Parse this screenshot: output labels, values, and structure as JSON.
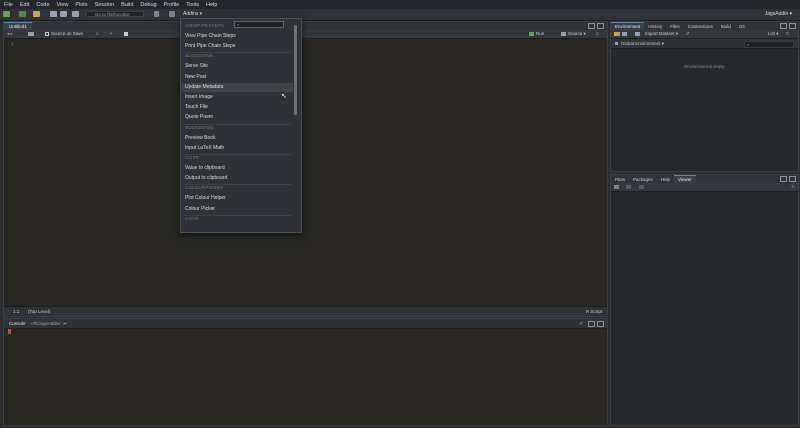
{
  "menu": [
    "File",
    "Edit",
    "Code",
    "View",
    "Plots",
    "Session",
    "Build",
    "Debug",
    "Profile",
    "Tools",
    "Help"
  ],
  "toolbar": {
    "goto_placeholder": "Go to file/function",
    "addins_label": "Addins ▾",
    "project_label": "JagsAddin ▾"
  },
  "editor": {
    "tab_label": "Untitled1",
    "source_on_save": "Source on Save",
    "run_label": "Run",
    "source_label": "Source ▾",
    "line_number": "1"
  },
  "statusbar": {
    "position": "1:1",
    "scope": "(Top Level)",
    "file_type": "R Script"
  },
  "console": {
    "tab_label": "Console",
    "path": "~/R/JagsAddin/"
  },
  "addins_menu": {
    "items": [
      {
        "kind": "head",
        "label": "VIEWPIPESTEPS"
      },
      {
        "kind": "item",
        "label": "View Pipe Chain Steps"
      },
      {
        "kind": "item",
        "label": "Print Pipe Chain Steps"
      },
      {
        "kind": "head",
        "label": "BLOGDOWN"
      },
      {
        "kind": "item",
        "label": "Serve Site"
      },
      {
        "kind": "item",
        "label": "New Post"
      },
      {
        "kind": "item",
        "label": "Update Metadata",
        "highlighted": true
      },
      {
        "kind": "item",
        "label": "Insert Image"
      },
      {
        "kind": "item",
        "label": "Touch File"
      },
      {
        "kind": "item",
        "label": "Quote Poem"
      },
      {
        "kind": "head",
        "label": "BOOKDOWN"
      },
      {
        "kind": "item",
        "label": "Preview Book"
      },
      {
        "kind": "item",
        "label": "Input LaTeX Math"
      },
      {
        "kind": "head",
        "label": "CLIPR"
      },
      {
        "kind": "item",
        "label": "Value to clipboard"
      },
      {
        "kind": "item",
        "label": "Output to clipboard"
      },
      {
        "kind": "head",
        "label": "COLOURPICKER"
      },
      {
        "kind": "item",
        "label": "Plot Colour Helper"
      },
      {
        "kind": "item",
        "label": "Colour Picker"
      },
      {
        "kind": "head",
        "label": "COVR"
      }
    ]
  },
  "env_pane": {
    "tabs": [
      "Environment",
      "History",
      "Files",
      "Connections",
      "Build",
      "Git"
    ],
    "active_tab": "Environment",
    "import_label": "Import Dataset ▾",
    "list_label": "List ▾",
    "global_env": "Global Environment ▾",
    "empty_text": "Environment is empty"
  },
  "viewer_pane": {
    "tabs": [
      "Plots",
      "Packages",
      "Help",
      "Viewer"
    ],
    "active_tab": "Viewer"
  },
  "colors": {
    "accent": "#5a88b5",
    "editor_bg": "#282722",
    "menu_bg": "#2e3236"
  }
}
